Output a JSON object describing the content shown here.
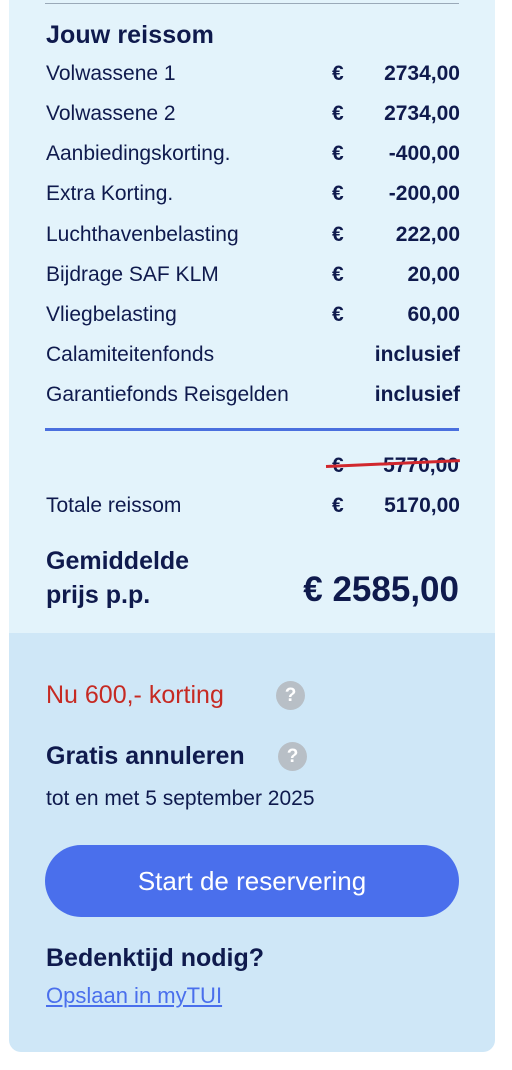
{
  "summary": {
    "heading": "Jouw reissom",
    "rows": [
      {
        "label": "Volwassene 1",
        "currency": "€",
        "amount": "2734,00"
      },
      {
        "label": "Volwassene 2",
        "currency": "€",
        "amount": "2734,00"
      },
      {
        "label": "Aanbiedingskorting.",
        "currency": "€",
        "amount": "-400,00"
      },
      {
        "label": "Extra Korting.",
        "currency": "€",
        "amount": "-200,00"
      },
      {
        "label": "Luchthavenbelasting",
        "currency": "€",
        "amount": "222,00"
      },
      {
        "label": "Bijdrage SAF KLM",
        "currency": "€",
        "amount": "20,00"
      },
      {
        "label": "Vliegbelasting",
        "currency": "€",
        "amount": "60,00"
      },
      {
        "label": "Calamiteitenfonds",
        "currency": "",
        "amount": "inclusief"
      },
      {
        "label": "Garantiefonds Reisgelden",
        "currency": "",
        "amount": "inclusief"
      }
    ],
    "old_total": {
      "currency": "€",
      "amount": "5770,00"
    },
    "total": {
      "label": "Totale reissom",
      "currency": "€",
      "amount": "5170,00"
    },
    "average": {
      "label_line1": "Gemiddelde",
      "label_line2": "prijs p.p.",
      "value": "€ 2585,00"
    }
  },
  "actions": {
    "promo_text": "Nu 600,- korting",
    "help_symbol": "?",
    "free_cancel_title": "Gratis annuleren",
    "free_cancel_until": "tot en met 5 september 2025",
    "start_button_label": "Start de reservering",
    "think_time_title": "Bedenktijd nodig?",
    "save_link_label": "Opslaan in myTUI"
  },
  "colors": {
    "navy_text": "#0f1a4d",
    "summary_bg": "#e3f3fb",
    "actions_bg": "#cfe7f7",
    "accent_blue": "#4a6fec",
    "promo_red": "#c62a23",
    "strike_red": "#d1272d"
  }
}
